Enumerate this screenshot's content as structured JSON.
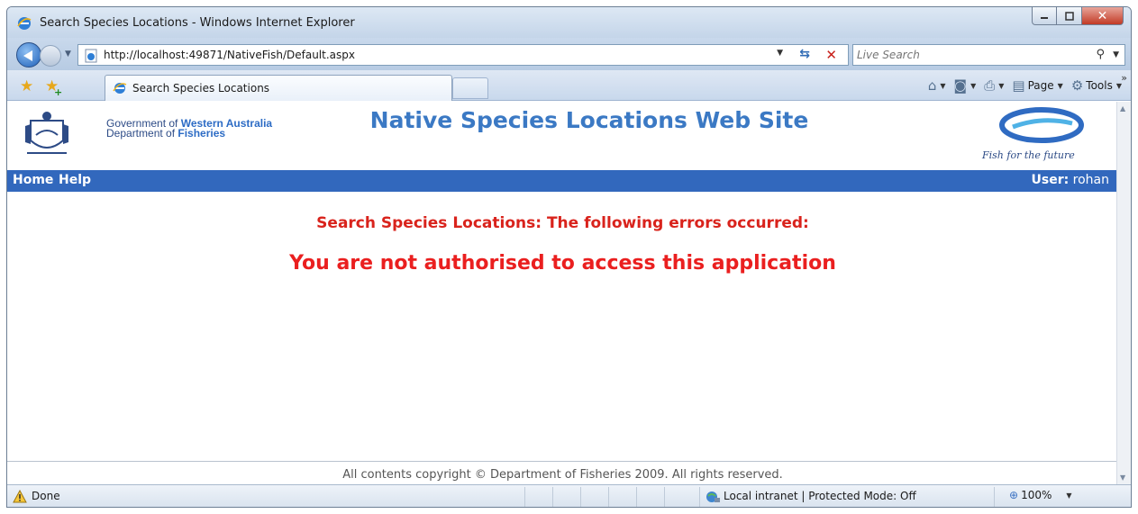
{
  "window": {
    "title": "Search Species Locations - Windows Internet Explorer"
  },
  "address": {
    "url": "http://localhost:49871/NativeFish/Default.aspx",
    "search_placeholder": "Live Search"
  },
  "tabs": [
    {
      "label": "Search Species Locations"
    }
  ],
  "commands": {
    "page_label": "Page",
    "tools_label": "Tools"
  },
  "site": {
    "gov_prefix": "Government of",
    "gov_name": "Western Australia",
    "dept_prefix": "Department of",
    "dept_name": "Fisheries",
    "title": "Native Species Locations Web Site",
    "tagline": "Fish for the future"
  },
  "menu": {
    "items": [
      "Home",
      "Help"
    ],
    "user_label": "User:",
    "user_name": "rohan"
  },
  "content": {
    "error_heading": "Search Species Locations: The following errors occurred:",
    "error_message": "You are not authorised to access this application"
  },
  "footer": {
    "copyright": "All contents copyright © Department of Fisheries 2009. All rights reserved."
  },
  "status": {
    "text": "Done",
    "zone": "Local intranet | Protected Mode: Off",
    "zoom": "100%"
  },
  "colors": {
    "menu_bar": "#3268bd",
    "site_title": "#3b79c4",
    "error_red": "#d9231c"
  }
}
